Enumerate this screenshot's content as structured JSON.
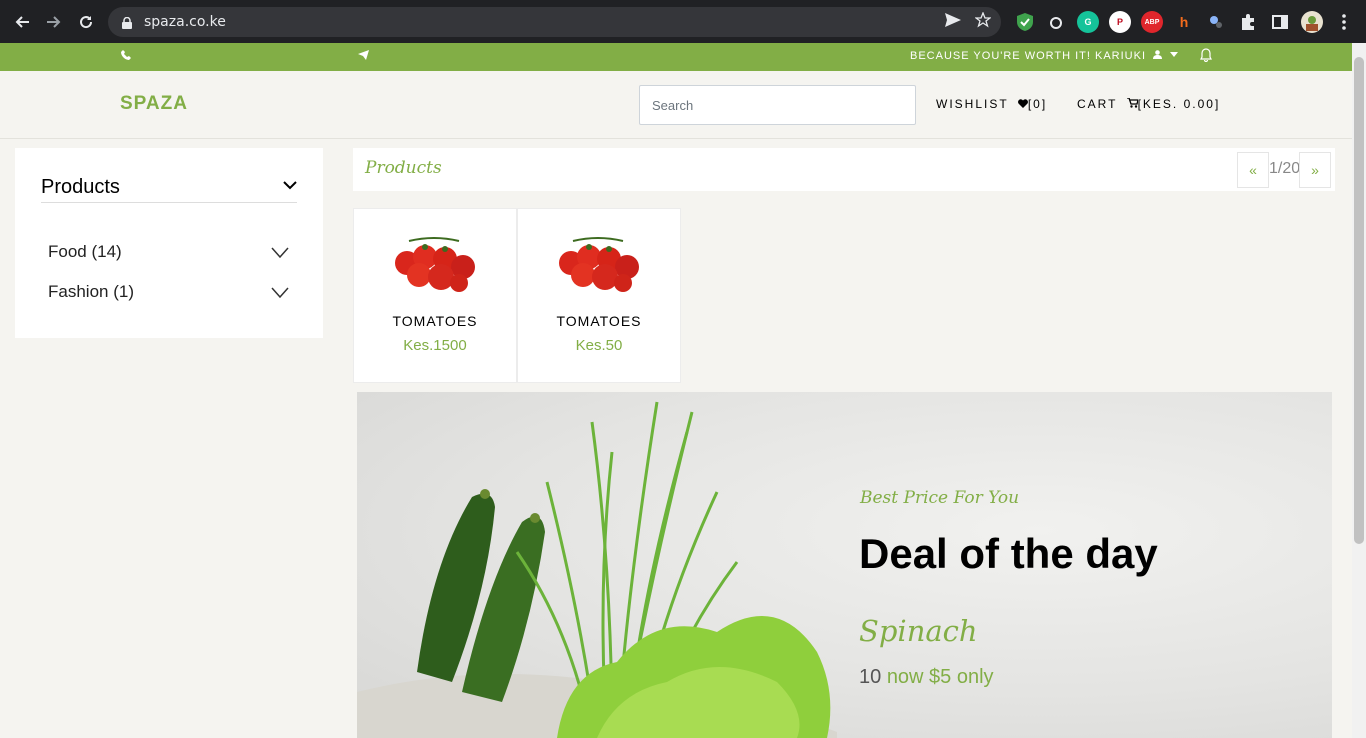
{
  "browser": {
    "url": "spaza.co.ke",
    "extensions": [
      "send-icon",
      "star-icon",
      "shield-icon",
      "puzzle-icon"
    ]
  },
  "topbar": {
    "tagline": "BECAUSE YOU'RE WORTH IT!",
    "user": "KARIUKI"
  },
  "header": {
    "logo": "SPAZA",
    "search_placeholder": "Search",
    "wishlist_label": "WISHLIST",
    "wishlist_count": "[0]",
    "cart_label": "CART",
    "cart_value": "[KES. 0.00]"
  },
  "sidebar": {
    "title": "Products",
    "categories": [
      {
        "label": "Food (14)"
      },
      {
        "label": "Fashion (1)"
      }
    ]
  },
  "products_bar": {
    "title": "Products",
    "prev": "«",
    "page": "1/20",
    "next": "»"
  },
  "products": [
    {
      "name": "TOMATOES",
      "price": "Kes.1500"
    },
    {
      "name": "TOMATOES",
      "price": "Kes.50"
    }
  ],
  "banner": {
    "tagline": "Best Price For You",
    "heading": "Deal of the day",
    "item": "Spinach",
    "old_price": "10",
    "new_price": "now $5 only"
  },
  "colors": {
    "accent": "#82ae46",
    "chrome": "#202124"
  }
}
